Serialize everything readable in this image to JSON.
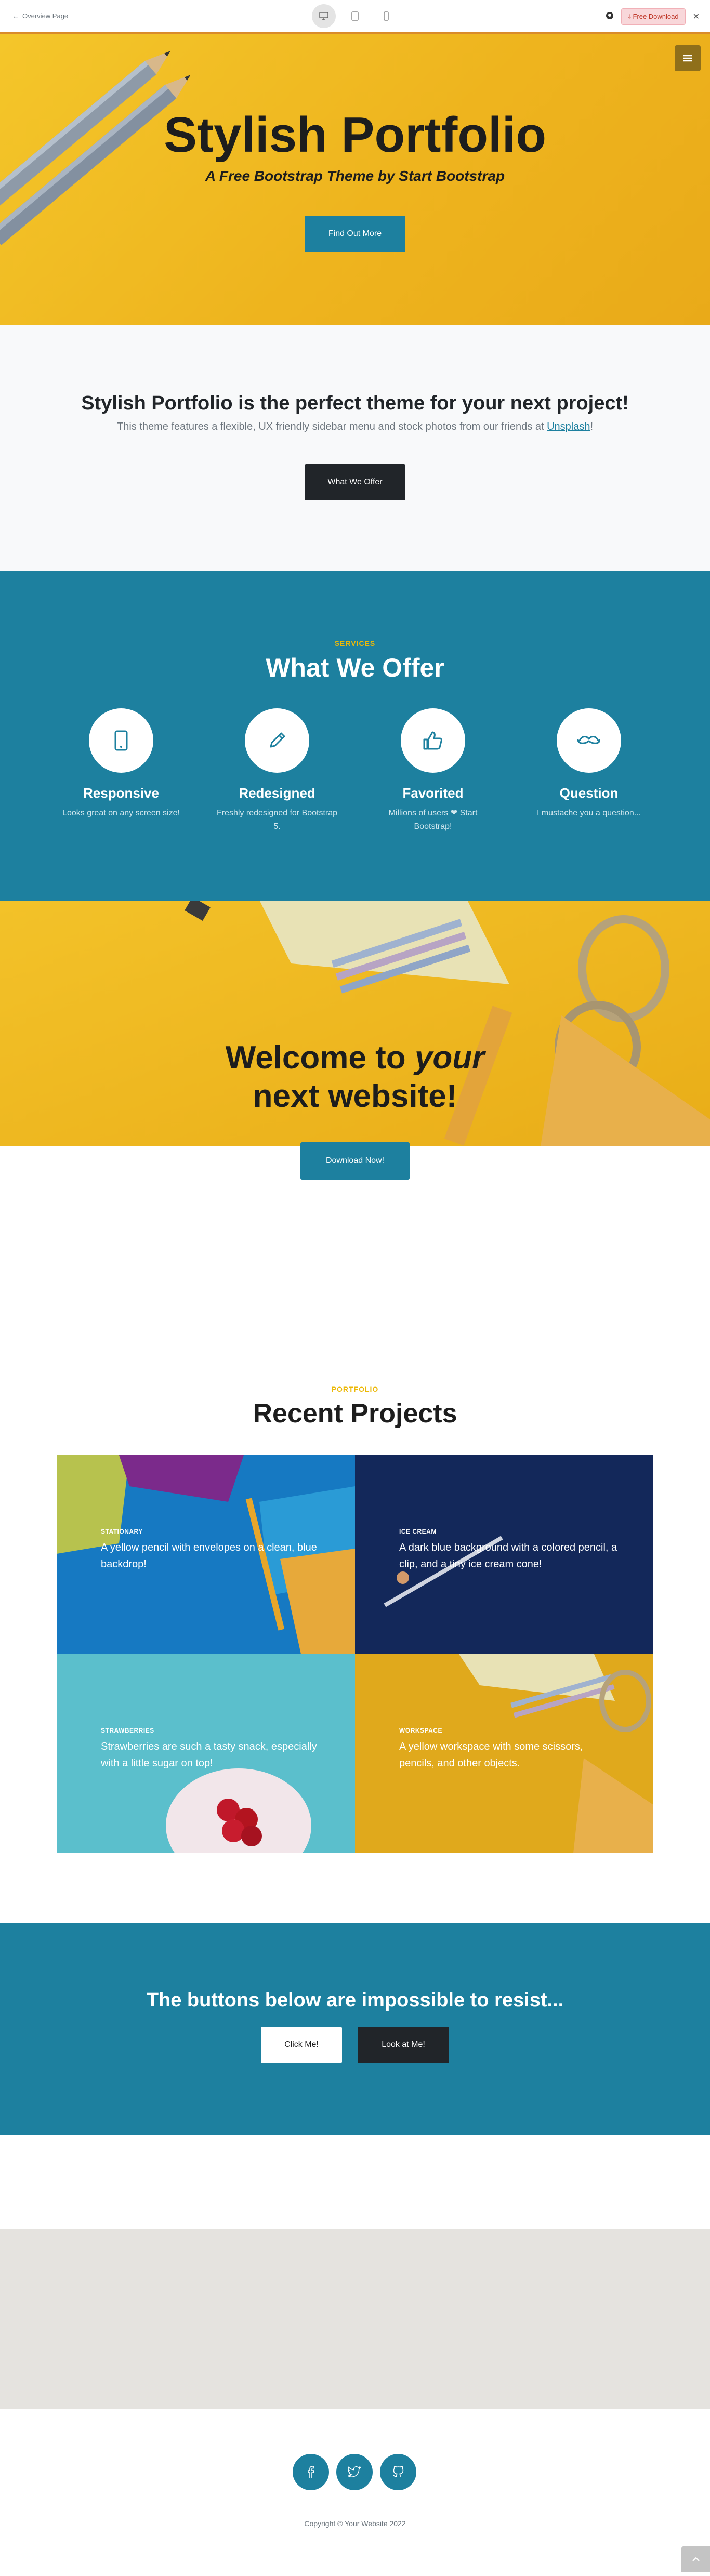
{
  "preview_bar": {
    "back_label": "Overview Page",
    "download_label": "Free Download"
  },
  "hero": {
    "title": "Stylish Portfolio",
    "subtitle": "A Free Bootstrap Theme by Start Bootstrap",
    "cta": "Find Out More"
  },
  "about": {
    "heading": "Stylish Portfolio is the perfect theme for your next project!",
    "text_before": "This theme features a flexible, UX friendly sidebar menu and stock photos from our friends at ",
    "link": "Unsplash",
    "text_after": "!",
    "button": "What We Offer"
  },
  "services": {
    "eyebrow": "SERVICES",
    "heading": "What We Offer",
    "items": [
      {
        "title": "Responsive",
        "text": "Looks great on any screen size!",
        "icon": "phone-icon"
      },
      {
        "title": "Redesigned",
        "text": "Freshly redesigned for Bootstrap 5.",
        "icon": "pencil-icon"
      },
      {
        "title": "Favorited",
        "text": "Millions of users ❤ Start Bootstrap!",
        "icon": "thumbs-up-icon"
      },
      {
        "title": "Question",
        "text": "I mustache you a question...",
        "icon": "mustache-icon"
      }
    ]
  },
  "callout": {
    "line1_prefix": "Welcome to ",
    "line1_emph": "your",
    "line2": "next website!",
    "button": "Download Now!"
  },
  "portfolio": {
    "eyebrow": "PORTFOLIO",
    "heading": "Recent Projects",
    "items": [
      {
        "name": "STATIONARY",
        "desc": "A yellow pencil with envelopes on a clean, blue backdrop!"
      },
      {
        "name": "ICE CREAM",
        "desc": "A dark blue background with a colored pencil, a clip, and a tiny ice cream cone!"
      },
      {
        "name": "STRAWBERRIES",
        "desc": "Strawberries are such a tasty snack, especially with a little sugar on top!"
      },
      {
        "name": "WORKSPACE",
        "desc": "A yellow workspace with some scissors, pencils, and other objects."
      }
    ]
  },
  "cta_band": {
    "heading": "The buttons below are impossible to resist...",
    "button1": "Click Me!",
    "button2": "Look at Me!"
  },
  "footer": {
    "copyright": "Copyright © Your Website 2022"
  },
  "colors": {
    "primary": "#1d809f",
    "secondary": "#ecb807",
    "dark": "#212529"
  }
}
